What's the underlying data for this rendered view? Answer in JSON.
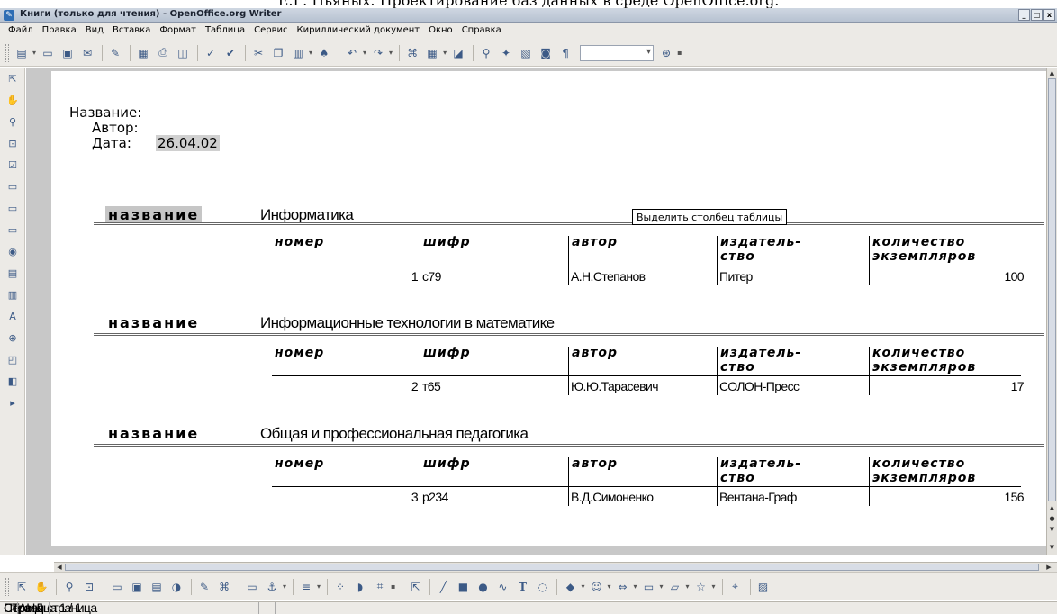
{
  "caption": "Е.Г. Пьяных. Проектирование баз данных в среде OpenOffice.org.",
  "window": {
    "title": "Книги (только для чтения) - OpenOffice.org Writer",
    "buttons": [
      "_",
      "□",
      "x"
    ]
  },
  "menu": [
    "Файл",
    "Правка",
    "Вид",
    "Вставка",
    "Формат",
    "Таблица",
    "Сервис",
    "Кириллический документ",
    "Окно",
    "Справка"
  ],
  "report": {
    "header": {
      "name_label": "Название:",
      "author_label": "Автор:",
      "date_label": "Дата:",
      "date_value": "26.04.02"
    },
    "record_label": "название",
    "columns": [
      "номер",
      "шифр",
      "автор",
      "издатель-\nство",
      "количество\nэкземпляров"
    ],
    "records": [
      {
        "title": "Информатика",
        "row": [
          "1",
          "с79",
          "А.Н.Степанов",
          "Питер",
          "100"
        ]
      },
      {
        "title": "Информационные технологии в математике",
        "row": [
          "2",
          "т65",
          "Ю.Ю.Тарасевич",
          "СОЛОН-Пресс",
          "17"
        ]
      },
      {
        "title": "Общая и профессиональная педагогика",
        "row": [
          "3",
          "р234",
          "В.Д.Симоненко",
          "Вентана-Граф",
          "156"
        ]
      }
    ]
  },
  "tooltip": "Выделить столбец таблицы",
  "statusbar": {
    "page": "Страница 1 / 1",
    "style": "Первая страница",
    "mode": "СТАНД"
  }
}
